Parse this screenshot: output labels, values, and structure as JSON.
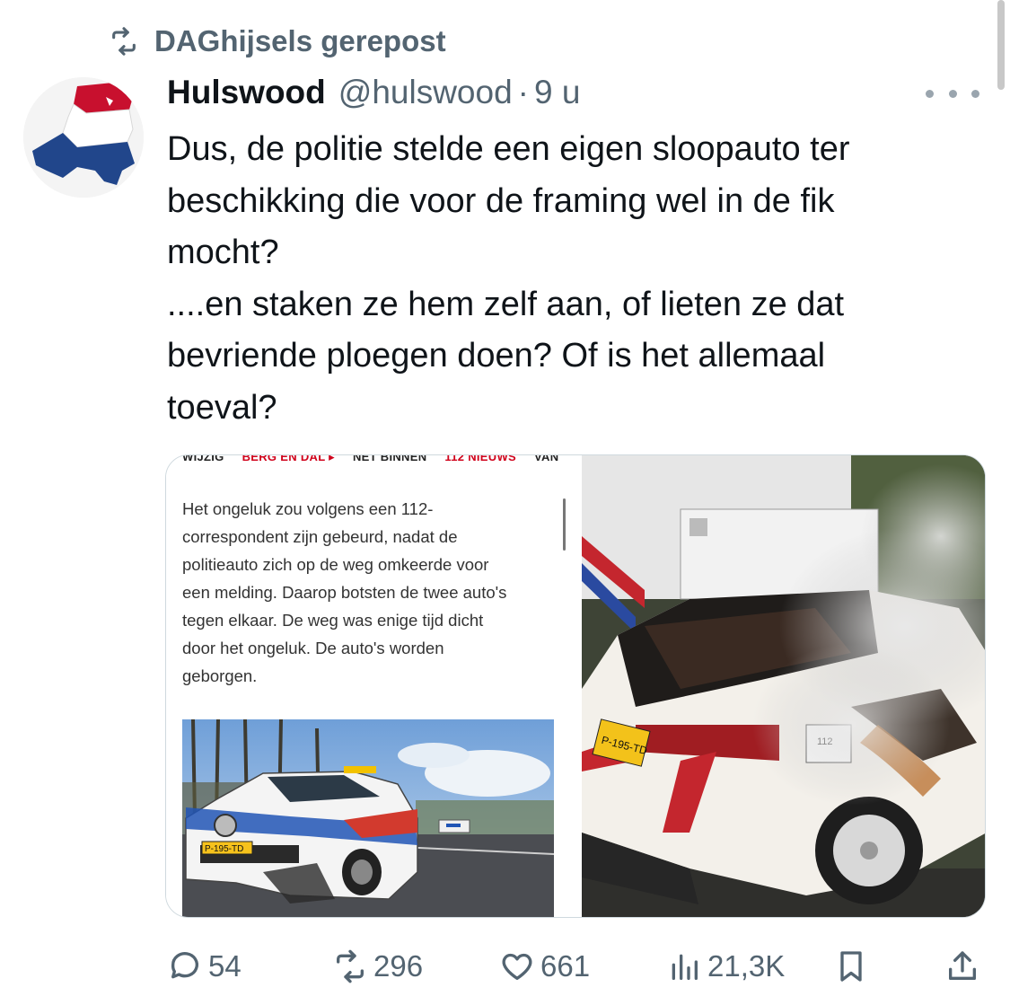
{
  "repost": {
    "text": "DAGhijsels gerepost",
    "icon": "repost-icon"
  },
  "author": {
    "display_name": "Hulswood",
    "handle": "@hulswood",
    "separator": "·",
    "time": "9 u",
    "avatar_icon": "netherlands-map-flag"
  },
  "tweet": {
    "lines": [
      "Dus, de politie stelde een eigen sloopauto ter",
      "beschikking die voor de framing wel in de fik",
      "mocht?",
      "....en staken ze hem zelf aan, of lieten ze dat",
      "bevriende ploegen doen? Of is het allemaal",
      "toeval?"
    ]
  },
  "media": {
    "article": {
      "nav": [
        "WIJZIG",
        "BERG EN DAL ▸",
        "NET BINNEN",
        "112 NIEUWS",
        "VAN"
      ],
      "lines": [
        "Het ongeluk zou volgens een 112-",
        "correspondent zijn gebeurd, nadat de",
        "politieauto zich op de weg omkeerde voor",
        "een melding. Daarop botsten de twee auto's",
        "tegen elkaar. De weg was enige tijd dicht",
        "door het ongeluk. De auto's worden",
        "geborgen."
      ],
      "plate": "P-195-TD"
    },
    "burned_car": {
      "plate": "P-195-TD",
      "sticker": "112"
    }
  },
  "actions": {
    "replies": "54",
    "reposts": "296",
    "likes": "661",
    "views": "21,3K",
    "icons": [
      "reply-icon",
      "repost-icon",
      "like-icon",
      "views-icon",
      "bookmark-icon",
      "share-icon"
    ]
  },
  "colors": {
    "text": "#0f1419",
    "secondary": "#536471",
    "border": "#cfd9de"
  }
}
